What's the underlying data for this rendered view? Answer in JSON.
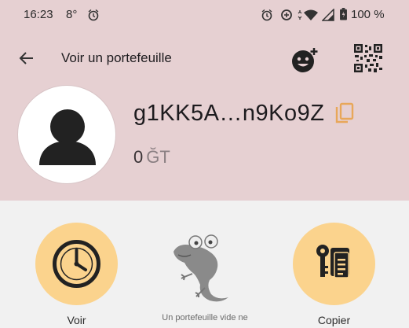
{
  "status_bar": {
    "time": "16:23",
    "temperature": "8°",
    "battery": "100 %",
    "icons": [
      "alarm-icon",
      "alarm-icon",
      "data-saver-icon",
      "wifi-icon",
      "signal-icon",
      "battery-icon"
    ]
  },
  "app_bar": {
    "title": "Voir un portefeuille",
    "icons": [
      "back-arrow-icon",
      "add-emoji-icon",
      "qr-code-icon"
    ]
  },
  "wallet": {
    "id": "g1KK5A…n9Ko9Z",
    "balance_amount": "0",
    "balance_unit": "ĞT"
  },
  "actions": {
    "history_label": "Voir",
    "empty_text": "Un portefeuille vide ne",
    "copy_label": "Copier"
  },
  "colors": {
    "header_bg": "#e6d0d2",
    "body_bg": "#f1f1f1",
    "accent_circle": "#fbd38d",
    "copy_icon": "#e8a75a"
  }
}
